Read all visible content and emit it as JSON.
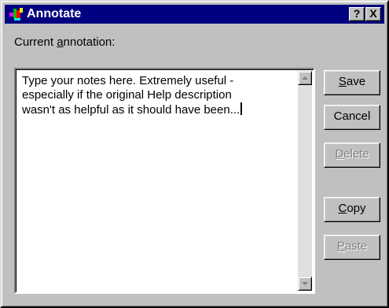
{
  "window": {
    "title": "Annotate",
    "help_label": "?",
    "close_label": "X"
  },
  "annotation": {
    "label_prefix": "Current ",
    "label_accel": "a",
    "label_suffix": "nnotation:",
    "text": "Type your notes here. Extremely useful -\nespecially if the original Help description\nwasn't as helpful as it should have been..."
  },
  "buttons": {
    "save": {
      "accel": "S",
      "rest": "ave"
    },
    "cancel": {
      "label": "Cancel"
    },
    "delete": {
      "accel": "D",
      "rest": "elete"
    },
    "copy": {
      "accel": "C",
      "rest": "opy"
    },
    "paste": {
      "accel": "P",
      "rest": "aste"
    }
  },
  "colors": {
    "titlebar": "#000080",
    "face": "#c0c0c0",
    "disabled_text": "#808080"
  },
  "icons": {
    "app": "annotate-app-icon",
    "scroll_up": "scroll-up-arrow-icon",
    "scroll_down": "scroll-down-arrow-icon"
  }
}
